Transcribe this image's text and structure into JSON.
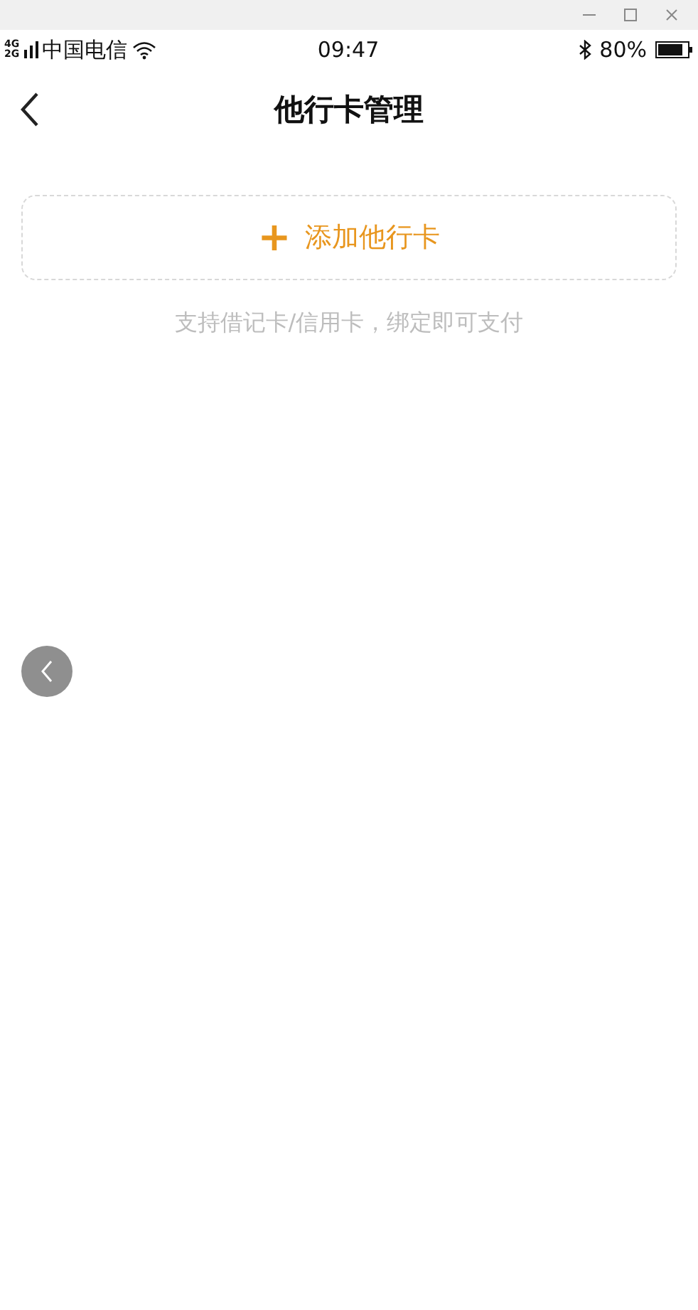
{
  "status_bar": {
    "network_top": "4G",
    "network_bottom": "2G",
    "carrier": "中国电信",
    "time": "09:47",
    "battery": "80%"
  },
  "nav": {
    "title": "他行卡管理"
  },
  "add_card": {
    "icon": "+",
    "label": "添加他行卡"
  },
  "hint": "支持借记卡/信用卡，绑定即可支付"
}
